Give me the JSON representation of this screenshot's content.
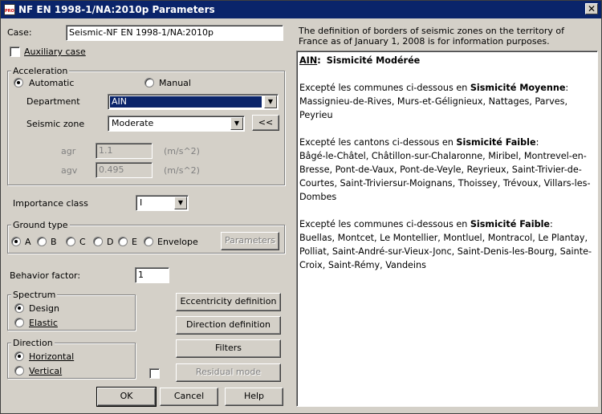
{
  "window": {
    "title": "NF EN 1998-1/NA:2010p Parameters",
    "close_glyph": "✕"
  },
  "case": {
    "label": "Case:",
    "value": "Seismic-NF EN 1998-1/NA:2010p"
  },
  "auxiliary_case": {
    "label": "Auxiliary case",
    "checked": false
  },
  "acceleration": {
    "title": "Acceleration",
    "automatic_label": "Automatic",
    "manual_label": "Manual",
    "selected": "Automatic",
    "department_label": "Department",
    "department_value": "AIN",
    "seismic_zone_label": "Seismic zone",
    "seismic_zone_value": "Moderate",
    "shift_button": "<<",
    "agr_label": "agr",
    "agr_value": "1.1",
    "agr_unit": "(m/s^2)",
    "agv_label": "agv",
    "agv_value": "0.495",
    "agv_unit": "(m/s^2)"
  },
  "importance_class": {
    "label": "Importance class",
    "value": "I"
  },
  "ground_type": {
    "title": "Ground type",
    "options": [
      "A",
      "B",
      "C",
      "D",
      "E",
      "Envelope"
    ],
    "selected": "A",
    "parameters_button": "Parameters"
  },
  "behavior_factor": {
    "label": "Behavior factor:",
    "value": "1"
  },
  "spectrum": {
    "title": "Spectrum",
    "design_label": "Design",
    "elastic_label": "Elastic",
    "selected": "Design"
  },
  "direction": {
    "title": "Direction",
    "horizontal_label": "Horizontal",
    "vertical_label": "Vertical",
    "selected": "Horizontal"
  },
  "buttons": {
    "eccentricity": "Eccentricity definition",
    "direction_definition": "Direction definition",
    "filters": "Filters",
    "residual_mode": "Residual mode",
    "ok": "OK",
    "cancel": "Cancel",
    "help": "Help"
  },
  "info": {
    "note": "The definition of borders of seismic zones on the territory of France as of January 1, 2008 is for information purposes.",
    "dept": "AIN",
    "dept_sep": ":",
    "dept_zone": "Sismicité Modérée",
    "p1_intro": "Excepté les communes ci-dessous en ",
    "p1_zone": "Sismicité Moyenne",
    "p1_list": "Massignieu-de-Rives, Murs-et-Gélignieux, Nattages, Parves, Peyrieu",
    "p2_intro": "Excepté les cantons ci-dessous en ",
    "p2_zone": "Sismicité Faible",
    "p2_list": "Bâgé-le-Châtel, Châtillon-sur-Chalaronne, Miribel, Montrevel-en-Bresse, Pont-de-Vaux, Pont-de-Veyle, Reyrieux, Saint-Trivier-de-Courtes, Saint-Triviersur-Moignans, Thoissey, Trévoux, Villars-les-Dombes",
    "p3_intro": "Excepté les communes ci-dessous en ",
    "p3_zone": "Sismicité Faible",
    "p3_list": "Buellas, Montcet, Le Montellier, Montluel, Montracol, Le Plantay, Polliat, Saint-André-sur-Vieux-Jonc, Saint-Denis-les-Bourg, Sainte-Croix, Saint-Rémy, Vandeins"
  }
}
